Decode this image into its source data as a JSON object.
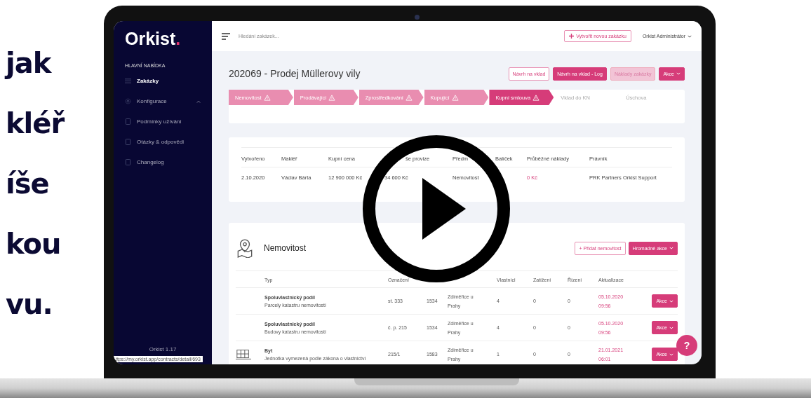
{
  "headline": [
    "jak",
    "kléř",
    "íše",
    "kou",
    "vu."
  ],
  "sidebar": {
    "logo": "Orkist",
    "logo_mark": ".",
    "section": "HLAVNÍ NABÍDKA",
    "items": [
      {
        "label": "Zakázky",
        "selected": true
      },
      {
        "label": "Konfigurace",
        "selected": false,
        "expanded": true
      },
      {
        "label": "Podmínky užívání",
        "selected": false
      },
      {
        "label": "Otázky & odpovědi",
        "selected": false
      },
      {
        "label": "Changelog",
        "selected": false
      }
    ],
    "version": "Orkist 1.17",
    "status_url": "ttps://my.orkist.app/contracts/detail/693"
  },
  "topbar": {
    "search_placeholder": "Hledání zakázek...",
    "create_button": "Vytvořit novou zakázku",
    "user": "Orkist Administrátor"
  },
  "page": {
    "title": "202069 - Prodej Müllerovy vily",
    "actions": [
      {
        "label": "Návrh na vklad",
        "kind": "outline"
      },
      {
        "label": "Návrh na vklad - Log",
        "kind": "solid"
      },
      {
        "label": "Náklady zakázky",
        "kind": "muted"
      },
      {
        "label": "Akce",
        "kind": "dropdown"
      }
    ]
  },
  "steps": [
    {
      "label": "Nemovitost",
      "completed": true,
      "selected": false,
      "warning": true
    },
    {
      "label": "Prodávající",
      "completed": true,
      "selected": false,
      "warning": true
    },
    {
      "label": "Zprostředkování",
      "completed": true,
      "selected": false,
      "warning": true
    },
    {
      "label": "Kupující",
      "completed": true,
      "selected": false,
      "warning": true
    },
    {
      "label": "Kupní smlouva",
      "completed": false,
      "selected": true,
      "warning": true
    },
    {
      "label": "Vklad do KN",
      "completed": false,
      "selected": false,
      "warning": false
    },
    {
      "label": "Úschova",
      "completed": false,
      "selected": false,
      "warning": false
    }
  ],
  "summary": {
    "columns": [
      {
        "header": "Vytvořeno",
        "value": "2.10.2020",
        "highlight": false
      },
      {
        "header": "Makléř",
        "value": "Václav Bárta",
        "highlight": false
      },
      {
        "header": "Kupní cena",
        "value": "12 900 000 Kč",
        "highlight": false
      },
      {
        "header": "še provize",
        "value": "34 600 Kč",
        "highlight": false
      },
      {
        "header": "Předm",
        "value": "Nemovitost",
        "highlight": false
      },
      {
        "header": "Balíček"
      },
      {
        "header": "Průběžné náklady",
        "value": "0 Kč",
        "highlight": true
      },
      {
        "header": "Právník",
        "value": "PRK Partners Orkist Support",
        "highlight": false
      }
    ]
  },
  "property": {
    "title": "Nemovitost",
    "add_button": "+ Přidat nemovitost",
    "bulk_button": "Hromadné akce",
    "columns": [
      "Typ",
      "Označení",
      null,
      null,
      "Vlastníci",
      "Zatížení",
      "Řízení",
      "Aktualizace"
    ],
    "rows": [
      {
        "kind": "share",
        "type": "Spoluvlastnický podíl",
        "subtype": "Parcely katastru nemovitostí",
        "label": "st. 333",
        "lv": "1534",
        "ku": "Zdiměřice u Prahy",
        "owners": "4",
        "liens": "0",
        "proceedings": "0",
        "updated": "05.10.2020 09:56",
        "action": "Akce"
      },
      {
        "kind": "share",
        "type": "Spoluvlastnický podíl",
        "subtype": "Budovy katastru nemovitostí",
        "label": "č. p. 215",
        "lv": "1534",
        "ku": "Zdiměřice u Prahy",
        "owners": "4",
        "liens": "0",
        "proceedings": "0",
        "updated": "05.10.2020 09:56",
        "action": "Akce"
      },
      {
        "kind": "unit",
        "type": "Byt",
        "subtype": "Jednotka vymezená podle zákona o vlastnictví",
        "label": "215/1",
        "lv": "1583",
        "ku": "Zdiměřice u Prahy",
        "owners": "1",
        "liens": "0",
        "proceedings": "0",
        "updated": "21.01.2021 06:01",
        "action": "Akce"
      }
    ]
  },
  "help_button": "?"
}
